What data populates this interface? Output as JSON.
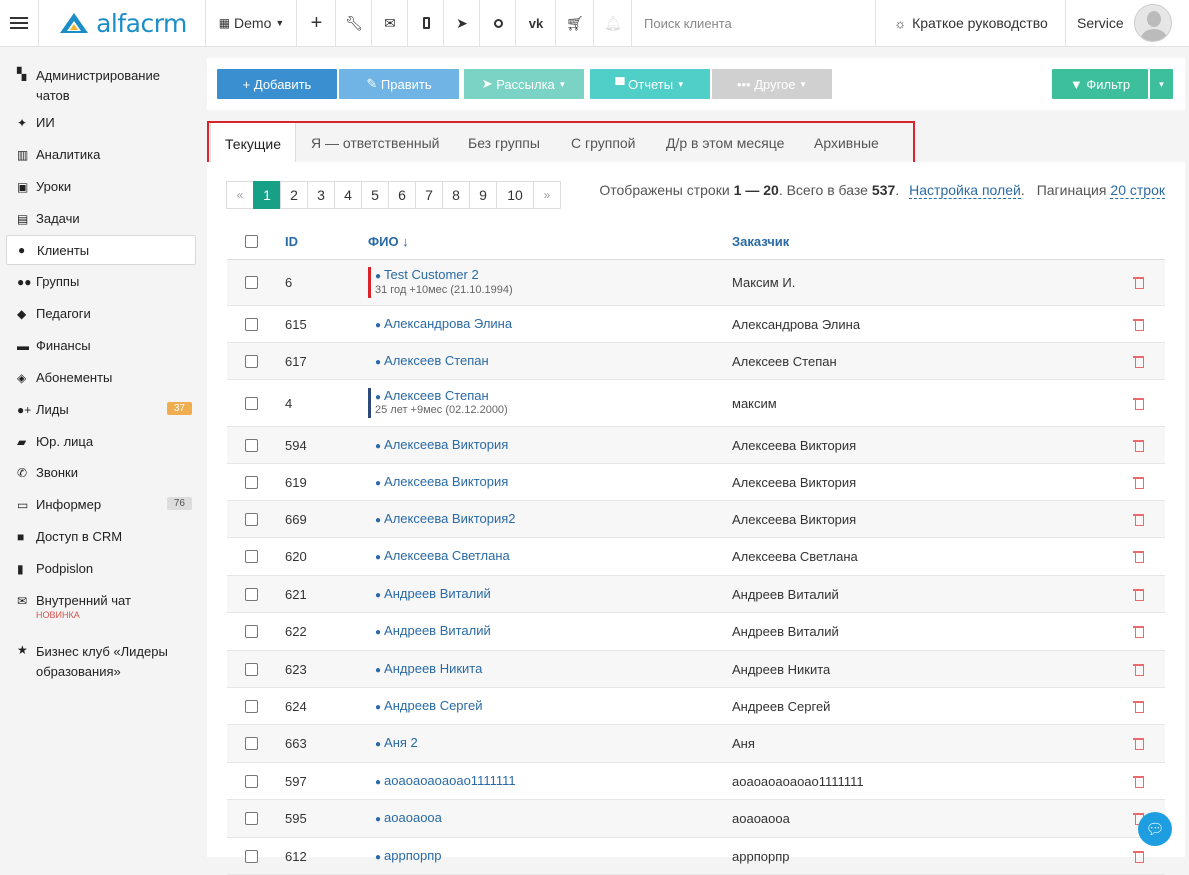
{
  "topbar": {
    "logo_text": "alfacrm",
    "branch": "Demo",
    "search_placeholder": "Поиск клиента",
    "guide_label": "Краткое руководство",
    "user_name": "Service",
    "brand_color": "#1b8ec7"
  },
  "sidebar": {
    "items": [
      {
        "label": "Администрирование чатов",
        "icon": "chat-icon"
      },
      {
        "label": "ИИ",
        "icon": "sparkle-icon"
      },
      {
        "label": "Аналитика",
        "icon": "map-icon"
      },
      {
        "label": "Уроки",
        "icon": "calendar-icon"
      },
      {
        "label": "Задачи",
        "icon": "clipboard-icon"
      },
      {
        "label": "Клиенты",
        "icon": "user-icon"
      },
      {
        "label": "Группы",
        "icon": "users-icon"
      },
      {
        "label": "Педагоги",
        "icon": "graduation-cap-icon"
      },
      {
        "label": "Финансы",
        "icon": "money-icon"
      },
      {
        "label": "Абонементы",
        "icon": "tag-icon"
      },
      {
        "label": "Лиды",
        "icon": "user-plus-icon",
        "badge": "37"
      },
      {
        "label": "Юр. лица",
        "icon": "briefcase-icon"
      },
      {
        "label": "Звонки",
        "icon": "phone-icon"
      },
      {
        "label": "Информер",
        "icon": "inbox-icon",
        "badge": "76"
      },
      {
        "label": "Доступ в CRM",
        "icon": "lock-icon"
      },
      {
        "label": "Podpislon",
        "icon": "file-icon"
      },
      {
        "label": "Внутренний чат",
        "icon": "envelope-icon",
        "tag": "НОВИНКА"
      },
      {
        "label": "Бизнес клуб «Лидеры образования»",
        "icon": "star-icon"
      }
    ]
  },
  "toolbar": {
    "add": "Добавить",
    "edit": "Править",
    "mailing": "Рассылка",
    "reports": "Отчеты",
    "other": "Другое",
    "filter": "Фильтр",
    "colors": {
      "add": "#3a8fd1",
      "edit": "#6fb4e4",
      "mailing": "#7ad3c4",
      "reports": "#4fcfc7",
      "other": "#d0d0d0",
      "filter": "#3dbf9b"
    }
  },
  "tabs": [
    {
      "label": "Текущие",
      "active": true
    },
    {
      "label": "Я — ответственный"
    },
    {
      "label": "Без группы"
    },
    {
      "label": "С группой"
    },
    {
      "label": "Д/р в этом месяце"
    },
    {
      "label": "Архивные"
    }
  ],
  "pagination": {
    "prev": "«",
    "next": "»",
    "pages": [
      "1",
      "2",
      "3",
      "4",
      "5",
      "6",
      "7",
      "8",
      "9",
      "10"
    ],
    "current": "1",
    "showing_prefix": "Отображены строки",
    "showing_range": "1 — 20",
    "total_prefix": ". Всего в базе",
    "total": "537",
    "total_suffix": ".",
    "fields_link": "Настройка полей",
    "per_page_label": "Пагинация",
    "per_page_value": "20 строк"
  },
  "table": {
    "headers": {
      "id": "ID",
      "name": "ФИО ↓",
      "customer": "Заказчик"
    },
    "rows": [
      {
        "id": "6",
        "name": "Test Customer 2",
        "sub": "31 год +10мес (21.10.1994)",
        "customer": "Максим И.",
        "marker": "#d9242b"
      },
      {
        "id": "615",
        "name": "Александрова Элина",
        "customer": "Александрова Элина"
      },
      {
        "id": "617",
        "name": "Алексеев Степан",
        "customer": "Алексеев Степан"
      },
      {
        "id": "4",
        "name": "Алексеев Степан",
        "sub": "25 лет +9мес (02.12.2000)",
        "customer": "максим",
        "marker": "#2b4a7a"
      },
      {
        "id": "594",
        "name": "Алексеева Виктория",
        "customer": "Алексеева Виктория"
      },
      {
        "id": "619",
        "name": "Алексеева Виктория",
        "customer": "Алексеева Виктория"
      },
      {
        "id": "669",
        "name": "Алексеева Виктория2",
        "customer": "Алексеева Виктория"
      },
      {
        "id": "620",
        "name": "Алексеева Светлана",
        "customer": "Алексеева Светлана"
      },
      {
        "id": "621",
        "name": "Андреев Виталий",
        "customer": "Андреев Виталий"
      },
      {
        "id": "622",
        "name": "Андреев Виталий",
        "customer": "Андреев Виталий"
      },
      {
        "id": "623",
        "name": "Андреев Никита",
        "customer": "Андреев Никита"
      },
      {
        "id": "624",
        "name": "Андреев Сергей",
        "customer": "Андреев Сергей"
      },
      {
        "id": "663",
        "name": "Аня 2",
        "customer": "Аня"
      },
      {
        "id": "597",
        "name": "аоаоаоаоаоао1111111",
        "customer": "аоаоаоаоаоао1111111"
      },
      {
        "id": "595",
        "name": "аоаоаооа",
        "customer": "аоаоаооа"
      },
      {
        "id": "612",
        "name": "аррпорпр",
        "customer": "аррпорпр"
      }
    ]
  }
}
